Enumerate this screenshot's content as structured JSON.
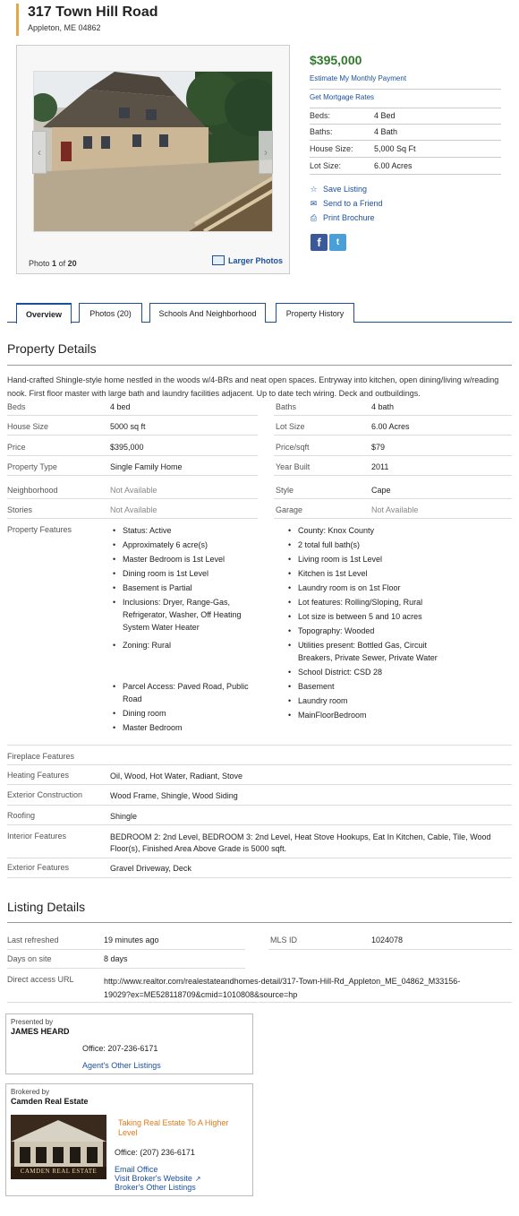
{
  "header": {
    "title": "317 Town Hill Road",
    "address": "Appleton, ME 04862"
  },
  "gallery": {
    "photo_index": "1",
    "photo_total": "20",
    "photo_prefix": "Photo",
    "photo_of": "of",
    "larger_label": "Larger Photos"
  },
  "summary": {
    "price": "$395,000",
    "estimate_link": "Estimate My Monthly Payment",
    "rates_link": "Get Mortgage Rates",
    "facts": [
      {
        "label": "Beds:",
        "value": "4 Bed"
      },
      {
        "label": "Baths:",
        "value": "4 Bath"
      },
      {
        "label": "House Size:",
        "value": "5,000 Sq Ft"
      },
      {
        "label": "Lot Size:",
        "value": "6.00 Acres"
      }
    ],
    "actions": {
      "save": "Save Listing",
      "send": "Send to a Friend",
      "print": "Print Brochure"
    },
    "social": {
      "facebook": "f",
      "twitter": "t"
    }
  },
  "tabs": [
    "Overview",
    "Photos (20)",
    "Schools And Neighborhood",
    "Property History"
  ],
  "property_details": {
    "title": "Property Details",
    "description": "Hand-crafted Shingle-style home nestled in the woods w/4-BRs and neat open spaces. Entryway into kitchen, open dining/living w/reading nook. First floor master with large bath and laundry facilities adjacent. Up to date tech wiring. Deck and outbuildings.",
    "rows": [
      {
        "l1": "Beds",
        "v1": "4 bed",
        "l2": "Baths",
        "v2": "4 bath"
      },
      {
        "l1": "House Size",
        "v1": "5000 sq ft",
        "l2": "Lot Size",
        "v2": "6.00 Acres"
      },
      {
        "l1": "Price",
        "v1": "$395,000",
        "l2": "Price/sqft",
        "v2": "$79"
      },
      {
        "l1": "Property Type",
        "v1": "Single Family Home",
        "l2": "Year Built",
        "v2": "2011"
      },
      {
        "l1": "Neighborhood",
        "v1": "Not Available",
        "l2": "Style",
        "v2": "Cape"
      },
      {
        "l1": "Stories",
        "v1": "Not Available",
        "l2": "Garage",
        "v2": "Not Available"
      }
    ],
    "features_label": "Property Features",
    "features_left": [
      "Status: Active",
      "Approximately 6 acre(s)",
      "Master Bedroom is 1st Level",
      "Dining room is 1st Level",
      "Basement is Partial",
      "Inclusions: Dryer, Range-Gas, Refrigerator, Washer, Off Heating System Water Heater",
      "Zoning: Rural",
      "Parcel Access: Paved Road, Public Road",
      "Dining room",
      "Master Bedroom"
    ],
    "features_right": [
      "County: Knox County",
      "2 total full bath(s)",
      "Living room is 1st Level",
      "Kitchen is 1st Level",
      "Laundry room is on 1st Floor",
      "Lot features: Rolling/Sloping, Rural",
      "Lot size is between 5 and 10 acres",
      "Topography: Wooded",
      "Utilities present: Bottled Gas, Circuit Breakers, Private Sewer, Private Water",
      "School District: CSD 28",
      "Basement",
      "Laundry room",
      "MainFloorBedroom"
    ],
    "extra": [
      {
        "label": "Fireplace Features",
        "value": ""
      },
      {
        "label": "Heating Features",
        "value": "Oil, Wood, Hot Water, Radiant, Stove"
      },
      {
        "label": "Exterior Construction",
        "value": "Wood Frame, Shingle, Wood Siding"
      },
      {
        "label": "Roofing",
        "value": "Shingle"
      },
      {
        "label": "Interior Features",
        "value": "BEDROOM 2: 2nd Level, BEDROOM 3: 2nd Level, Heat Stove Hookups, Eat In Kitchen, Cable, Tile, Wood Floor(s), Finished Area Above Grade is 5000 sqft."
      },
      {
        "label": "Exterior Features",
        "value": "Gravel Driveway, Deck"
      }
    ]
  },
  "listing_details": {
    "title": "Listing Details",
    "last_refreshed_label": "Last refreshed",
    "last_refreshed": "19 minutes ago",
    "mls_label": "MLS ID",
    "mls": "1024078",
    "days_label": "Days on site",
    "days": "8 days",
    "url_label": "Direct access URL",
    "url": "http://www.realtor.com/realestateandhomes-detail/317-Town-Hill-Rd_Appleton_ME_04862_M33156-19029?ex=ME528118709&cmid=1010808&source=hp"
  },
  "presented_by": {
    "heading": "Presented by",
    "name": "JAMES HEARD",
    "office": "Office: 207-236-6171",
    "other_link": "Agent's Other Listings"
  },
  "brokered_by": {
    "heading": "Brokered by",
    "name": "Camden Real Estate",
    "tagline": "Taking Real Estate To A Higher Level",
    "office": "Office: (207) 236-6171",
    "email": "Email Office",
    "website": "Visit Broker's Website",
    "other": "Broker's Other Listings",
    "logo_text": "CAMDEN REAL ESTATE"
  },
  "colors": {
    "price": "#2f7a2b",
    "link": "#1a4f9c",
    "tagline": "#e07a1a",
    "accent": "#e2a94a"
  }
}
